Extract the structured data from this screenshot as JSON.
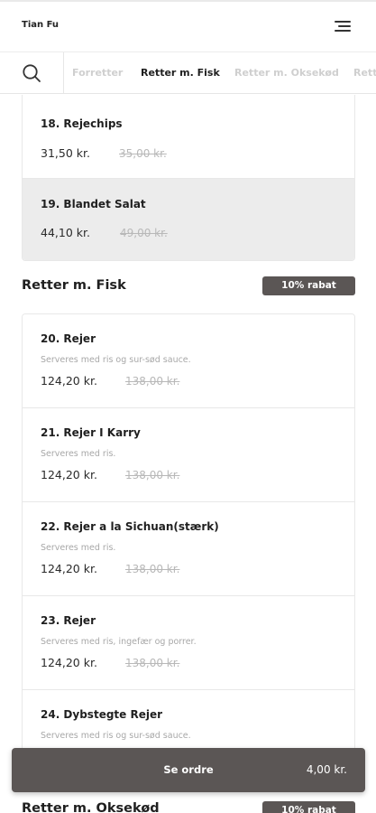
{
  "header": {
    "brand": "Tian Fu",
    "menu_icon": "hamburger-menu-icon"
  },
  "tabs": {
    "search_icon": "search-icon",
    "items": [
      {
        "label": "Forretter",
        "active": false
      },
      {
        "label": "Retter m. Fisk",
        "active": true
      },
      {
        "label": "Retter m. Oksekød",
        "active": false
      },
      {
        "label": "Retter m. Kylling",
        "active": false
      }
    ]
  },
  "prev_section": {
    "items": [
      {
        "name": "18. Rejechips",
        "price": "31,50 kr.",
        "old_price": "35,00 kr.",
        "selected": false
      },
      {
        "name": "19. Blandet Salat",
        "price": "44,10 kr.",
        "old_price": "49,00 kr.",
        "selected": true
      }
    ]
  },
  "fish_section": {
    "title": "Retter m. Fisk",
    "badge": "10% rabat",
    "items": [
      {
        "name": "20. Rejer",
        "desc": "Serveres med ris og sur-sød sauce.",
        "price": "124,20 kr.",
        "old_price": "138,00 kr."
      },
      {
        "name": "21. Rejer I Karry",
        "desc": "Serveres med ris.",
        "price": "124,20 kr.",
        "old_price": "138,00 kr."
      },
      {
        "name": "22. Rejer a la Sichuan(stærk)",
        "desc": "Serveres med ris.",
        "price": "124,20 kr.",
        "old_price": "138,00 kr."
      },
      {
        "name": "23. Rejer",
        "desc": "Serveres med ris, ingefær og porrer.",
        "price": "124,20 kr.",
        "old_price": "138,00 kr."
      },
      {
        "name": "24. Dybstegte Rejer",
        "desc": "Serveres med ris og sur-sød sauce.",
        "price": "",
        "old_price": ""
      }
    ]
  },
  "next_section": {
    "title": "Retter m. Oksekød",
    "badge": "10% rabat"
  },
  "order_bar": {
    "label": "Se ordre",
    "total": "4,00 kr."
  },
  "colors": {
    "accent": "#5b5655",
    "selected_row": "#ececec"
  }
}
